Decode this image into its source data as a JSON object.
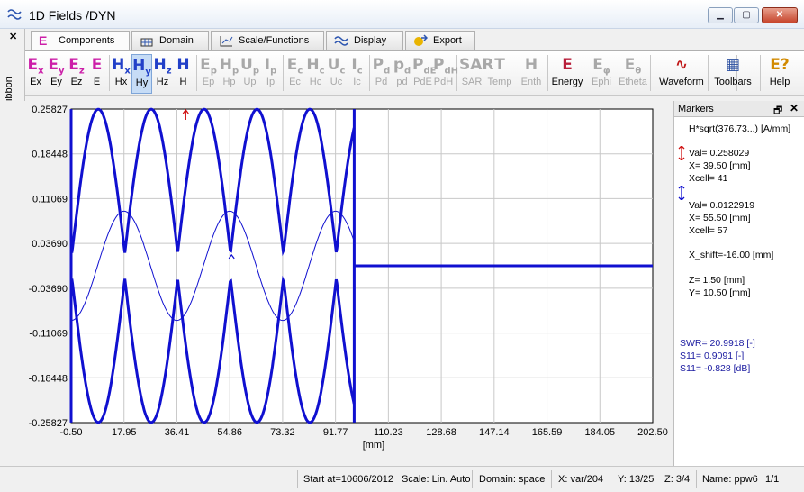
{
  "window": {
    "title": "1D Fields /DYN",
    "minimize": "▁",
    "maximize": "▢",
    "close": "✕"
  },
  "ribbon": {
    "side_label": "Ribbon",
    "close_glyph": "✕",
    "tabs": [
      {
        "label": "Components",
        "icon": "component-e-icon",
        "active": true
      },
      {
        "label": "Domain",
        "icon": "domain-icon",
        "active": false
      },
      {
        "label": "Scale/Functions",
        "icon": "scale-icon",
        "active": false
      },
      {
        "label": "Display",
        "icon": "display-icon",
        "active": false
      },
      {
        "label": "Export",
        "icon": "export-icon",
        "active": false
      }
    ],
    "buttons": [
      {
        "glyph": "E",
        "sub": "x",
        "label": "Ex",
        "color": "#cc1fa8"
      },
      {
        "glyph": "E",
        "sub": "y",
        "label": "Ey",
        "color": "#cc1fa8"
      },
      {
        "glyph": "E",
        "sub": "z",
        "label": "Ez",
        "color": "#cc1fa8"
      },
      {
        "glyph": "E",
        "sub": "",
        "label": "E",
        "color": "#cc1fa8"
      },
      {
        "glyph": "H",
        "sub": "x",
        "label": "Hx",
        "color": "#2240c8"
      },
      {
        "glyph": "H",
        "sub": "y",
        "label": "Hy",
        "color": "#2240c8",
        "pressed": true
      },
      {
        "glyph": "H",
        "sub": "z",
        "label": "Hz",
        "color": "#2240c8"
      },
      {
        "glyph": "H",
        "sub": "",
        "label": "H",
        "color": "#2240c8"
      },
      {
        "glyph": "E",
        "sub": "p",
        "label": "Ep",
        "disabled": true
      },
      {
        "glyph": "H",
        "sub": "p",
        "label": "Hp",
        "disabled": true
      },
      {
        "glyph": "U",
        "sub": "p",
        "label": "Up",
        "disabled": true
      },
      {
        "glyph": "I",
        "sub": "p",
        "label": "Ip",
        "disabled": true
      },
      {
        "glyph": "E",
        "sub": "c",
        "label": "Ec",
        "disabled": true
      },
      {
        "glyph": "H",
        "sub": "c",
        "label": "Hc",
        "disabled": true
      },
      {
        "glyph": "U",
        "sub": "c",
        "label": "Uc",
        "disabled": true
      },
      {
        "glyph": "I",
        "sub": "c",
        "label": "Ic",
        "disabled": true
      },
      {
        "glyph": "P",
        "sub": "d",
        "label": "Pd",
        "disabled": true
      },
      {
        "glyph": "p",
        "sub": "d",
        "label": "pd",
        "disabled": true
      },
      {
        "glyph": "P",
        "sub": "dE",
        "label": "PdE",
        "disabled": true
      },
      {
        "glyph": "P",
        "sub": "dH",
        "label": "PdH",
        "disabled": true
      },
      {
        "glyph": "SAR",
        "sub": "",
        "label": "SAR",
        "disabled": true
      },
      {
        "glyph": "T",
        "sub": "",
        "label": "Temp",
        "disabled": true
      },
      {
        "glyph": "H",
        "sub": "",
        "label": "Enth",
        "disabled": true
      },
      {
        "glyph": "E",
        "sub": "",
        "label": "Energy",
        "color": "#b81e3a"
      },
      {
        "glyph": "E",
        "sub": "φ",
        "label": "Ephi",
        "disabled": true
      },
      {
        "glyph": "E",
        "sub": "θ",
        "label": "Etheta",
        "disabled": true
      },
      {
        "glyph": "∿",
        "sub": "",
        "label": "Waveform",
        "color": "#c01818"
      },
      {
        "glyph": "▦",
        "sub": "",
        "label": "Toolbars",
        "color": "#2b4fa0"
      },
      {
        "glyph": "E?",
        "sub": "",
        "label": "Help",
        "color": "#d28a00"
      }
    ]
  },
  "plot": {
    "xlabel": "[mm]",
    "series_color": "#1010d0",
    "marker1_color": "#d01010",
    "marker2_color": "#1010d0"
  },
  "chart_data": {
    "type": "line",
    "title": "",
    "xlabel": "[mm]",
    "ylabel": "",
    "xlim": [
      -0.5,
      202.5
    ],
    "ylim": [
      -0.25827,
      0.25827
    ],
    "xticks": [
      "-0.50",
      "17.95",
      "36.41",
      "54.86",
      "73.32",
      "91.77",
      "110.23",
      "128.68",
      "147.14",
      "165.59",
      "184.05",
      "202.50"
    ],
    "yticks": [
      "0.25827",
      "0.18448",
      "0.11069",
      "0.03690",
      "-0.03690",
      "-0.11069",
      "-0.18448",
      "-0.25827"
    ],
    "grid": true,
    "series": [
      {
        "style": "thick-envelope",
        "x": [
          0,
          10,
          20,
          30,
          40,
          50,
          60,
          70,
          80,
          90,
          100
        ],
        "upper": [
          0.258,
          0.258,
          0.258,
          0.02,
          0.258,
          0.02,
          0.258,
          0.258,
          0.02,
          0.258,
          0.258
        ],
        "note_points": "oscillating envelope from x=-0.5 to 98"
      },
      {
        "style": "thin",
        "x": [
          -0.5,
          9,
          18,
          27,
          36.4,
          45.7,
          55,
          64,
          73.3,
          82.5,
          91.8,
          98
        ],
        "y": [
          -0.03,
          -0.075,
          -0.07,
          0.0,
          0.09,
          0.07,
          0.0,
          -0.07,
          -0.075,
          0.0,
          0.07,
          0.09
        ]
      },
      {
        "style": "flat",
        "x": [
          98,
          202.5
        ],
        "y": [
          0.0,
          0.0
        ]
      }
    ]
  },
  "markers": {
    "title": "Markers",
    "pin": "🗗",
    "close": "✕",
    "quantity": "H*sqrt(376.73...) [A/mm]",
    "m1_val": "Val= 0.258029",
    "m1_x": "X= 39.50 [mm]",
    "m1_xcell": "Xcell= 41",
    "m2_val": "Val= 0.0122919",
    "m2_x": "X= 55.50 [mm]",
    "m2_xcell": "Xcell= 57",
    "xshift": "X_shift=-16.00 [mm]",
    "z": "Z=  1.50 [mm]",
    "y": "Y= 10.50 [mm]",
    "swr": "SWR= 20.9918 [-]",
    "s11_lin": "S11=  0.9091 [-]",
    "s11_db": "S11=  -0.828 [dB]"
  },
  "status": {
    "start": "Start at=10606/2012",
    "scale": "Scale: Lin. Auto",
    "domain": "Domain: space",
    "x": "X: var/204",
    "y": "Y: 13/25",
    "z": "Z: 3/4",
    "name": "Name:  ppw6",
    "page": "1/1"
  }
}
